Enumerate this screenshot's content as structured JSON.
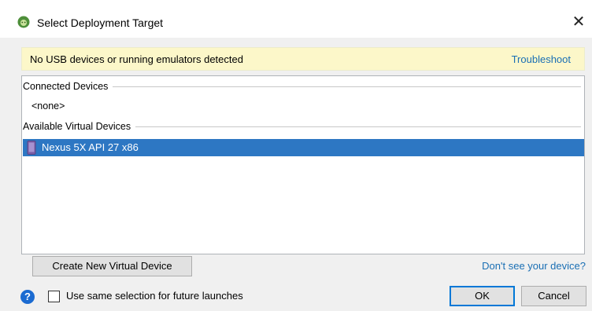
{
  "window": {
    "title": "Select Deployment Target",
    "close_symbol": "✕",
    "app_icon": "android-studio-icon"
  },
  "banner": {
    "message": "No USB devices or running emulators detected",
    "link": "Troubleshoot"
  },
  "connected": {
    "header": "Connected Devices",
    "none": "<none>"
  },
  "available": {
    "header": "Available Virtual Devices",
    "devices": [
      {
        "label": "Nexus 5X API 27 x86",
        "icon": "phone-icon",
        "selected": true
      }
    ]
  },
  "actions": {
    "create_button": "Create New Virtual Device",
    "dont_see_link": "Don't see your device?",
    "help_symbol": "?",
    "remember_checkbox_label": "Use same selection for future launches",
    "remember_checked": false,
    "ok": "OK",
    "cancel": "Cancel"
  },
  "colors": {
    "selection": "#2d77c3",
    "banner_bg": "#fcf7c9",
    "link": "#1a6fb4"
  }
}
